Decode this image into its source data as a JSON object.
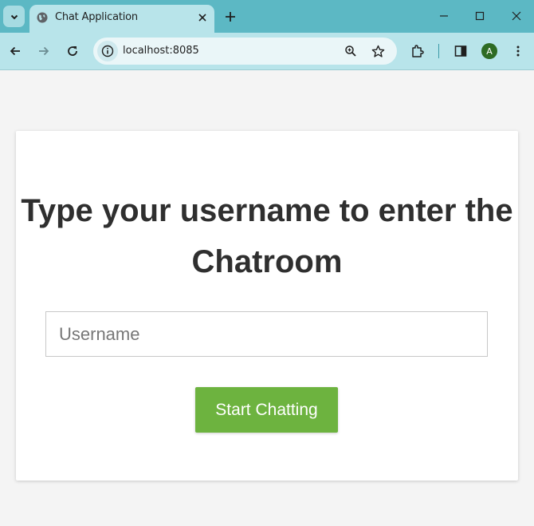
{
  "browser": {
    "tab_title": "Chat Application",
    "url": "localhost:8085",
    "profile_initial": "A",
    "icons": {
      "tab_search": "chevron-down-icon",
      "favicon": "globe-icon",
      "tab_close": "close-icon",
      "new_tab": "plus-icon",
      "back": "arrow-left-icon",
      "forward": "arrow-right-icon",
      "reload": "reload-icon",
      "site_info": "info-icon",
      "zoom": "zoom-icon",
      "bookmark": "star-icon",
      "extensions": "puzzle-icon",
      "side_panel": "side-panel-icon",
      "menu": "kebab-menu-icon",
      "minimize": "minimize-icon",
      "maximize": "maximize-icon",
      "close_window": "close-icon"
    },
    "colors": {
      "frame": "#5cb8c4",
      "toolbar": "#b8e4ea",
      "avatar": "#2e6b24"
    }
  },
  "page": {
    "heading": "Type your username to enter the Chatroom",
    "username_placeholder": "Username",
    "username_value": "",
    "start_button": "Start Chatting",
    "colors": {
      "background": "#f4f4f4",
      "card": "#ffffff",
      "button": "#6db33f",
      "heading": "#2f2f2f"
    }
  }
}
